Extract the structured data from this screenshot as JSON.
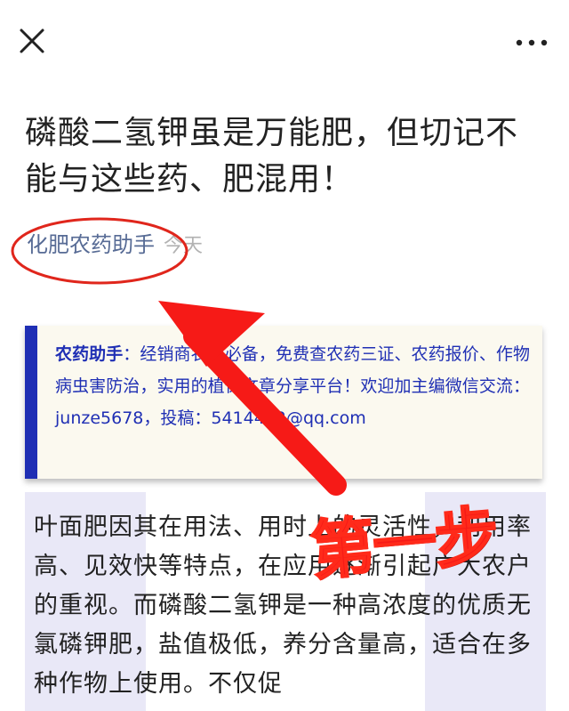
{
  "topbar": {
    "close_icon": "close-icon",
    "more_icon": "more-dots-icon"
  },
  "article": {
    "title": "磷酸二氢钾虽是万能肥，但切记不能与这些药、肥混用！",
    "author": "化肥农药助手",
    "date": "今天"
  },
  "promo": {
    "label": "农药助手",
    "text": "：经销商农户必备，免费查农药三证、农药报价、作物病虫害防治，实用的植保文章分享平台！欢迎加主编微信交流：junze5678，投稿：5414402@qq.com"
  },
  "body": {
    "paragraph": "叶面肥因其在用法、用时上的灵活性，利用率高、见效快等特点，在应用逐渐引起广大农户的重视。而磷酸二氢钾是一种高浓度的优质无氯磷钾肥，盐值极低，养分含量高，适合在多种作物上使用。不仅促"
  },
  "annotation": {
    "step_label": "第一步",
    "color": "#f61a17"
  },
  "colors": {
    "author_link": "#576b95",
    "promo_text": "#1f2fb4",
    "promo_bg": "#fbf9ef",
    "body_highlight": "#e9e8f7"
  }
}
